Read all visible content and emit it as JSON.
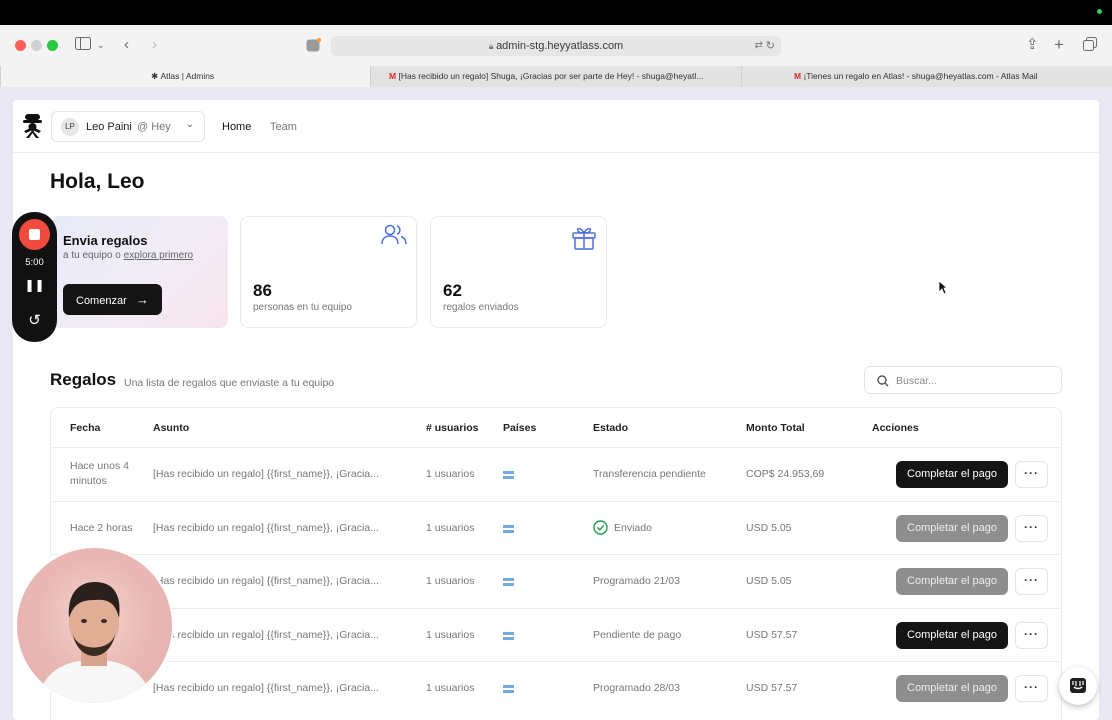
{
  "browser": {
    "url": "admin-stg.heyyatlass.com",
    "tabs": [
      {
        "label": "Atlas | Admins",
        "favicon": "atlas-logo"
      },
      {
        "label": "[Has recibido un regalo] Shuga, ¡Gracias por ser parte de Hey! - shuga@heyatl...",
        "favicon": "gmail"
      },
      {
        "label": "¡Tienes un regalo en Atlas! - shuga@heyatlas.com - Atlas Mail",
        "favicon": "gmail"
      }
    ]
  },
  "topnav": {
    "user_initials": "LP",
    "user_name": "Leo Paini",
    "org": "@ Hey",
    "links": [
      "Home",
      "Team"
    ]
  },
  "greeting": "Hola, Leo",
  "hero": {
    "title": "Envia regalos",
    "subtitle_prefix": "a tu equipo o",
    "subtitle_link": "explora primero",
    "button": "Comenzar"
  },
  "stats": [
    {
      "value": "86",
      "label": "personas en tu equipo",
      "icon": "users-icon"
    },
    {
      "value": "62",
      "label": "regalos enviados",
      "icon": "gift-icon"
    }
  ],
  "gifts": {
    "title": "Regalos",
    "subtitle": "Una lista de regalos que enviaste a tu equipo",
    "search_placeholder": "Buscar...",
    "columns": [
      "Fecha",
      "Asunto",
      "# usuarios",
      "Países",
      "Estado",
      "Monto Total",
      "Acciones"
    ],
    "rows": [
      {
        "fecha": "Hace unos 4 minutos",
        "asunto": "[Has recibido un regalo] {{first_name}}, ¡Gracia...",
        "usuarios": "1 usuarios",
        "estado": "Transferencia pendiente",
        "monto": "COP$ 24.953,69",
        "action": "Completar el pago",
        "action_enabled": true
      },
      {
        "fecha": "Hace 2 horas",
        "asunto": "[Has recibido un regalo] {{first_name}}, ¡Gracia...",
        "usuarios": "1 usuarios",
        "estado": "Enviado",
        "monto": "USD 5.05",
        "action": "Completar el pago",
        "action_enabled": false
      },
      {
        "fecha": "",
        "asunto": "[Has recibido un regalo] {{first_name}}, ¡Gracia...",
        "usuarios": "1 usuarios",
        "estado": "Programado 21/03",
        "monto": "USD 5.05",
        "action": "Completar el pago",
        "action_enabled": false
      },
      {
        "fecha": "",
        "asunto": "[Has recibido un regalo] {{first_name}}, ¡Gracia...",
        "usuarios": "1 usuarios",
        "estado": "Pendiente de pago",
        "monto": "USD 57.57",
        "action": "Completar el pago",
        "action_enabled": true
      },
      {
        "fecha": "",
        "asunto": "[Has recibido un regalo] {{first_name}}, ¡Gracia...",
        "usuarios": "1 usuarios",
        "estado": "Programado 28/03",
        "monto": "USD 57.57",
        "action": "Completar el pago",
        "action_enabled": false
      }
    ],
    "more_label": "···"
  },
  "recorder": {
    "time": "5:00"
  },
  "colors": {
    "accent_blue": "#4c6fe0",
    "success_green": "#1f9a4a",
    "record_red": "#f14a3f",
    "flag_blue": "#74acdf"
  }
}
